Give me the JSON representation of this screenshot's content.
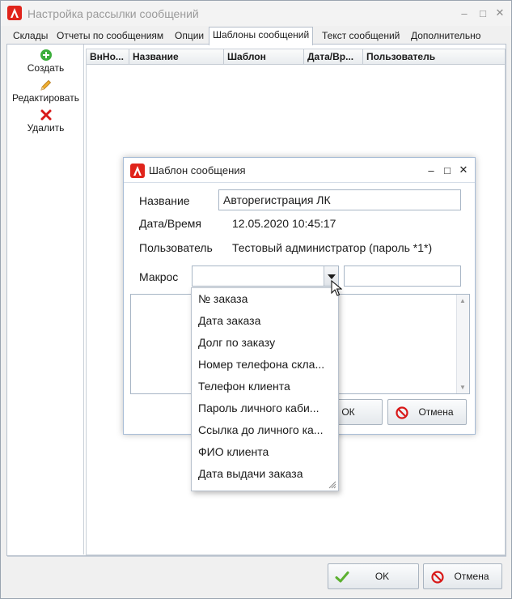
{
  "window": {
    "title": "Настройка рассылки сообщений",
    "minimize": "‒",
    "maximize": "□",
    "close": "✕"
  },
  "tabs": [
    {
      "label": "Склады"
    },
    {
      "label": "Отчеты по сообщениям"
    },
    {
      "label": "Опции"
    },
    {
      "label": "Шаблоны сообщений",
      "active": true
    },
    {
      "label": "Текст сообщений"
    },
    {
      "label": "Дополнительно"
    }
  ],
  "toolbar": {
    "create": "Создать",
    "edit": "Редактировать",
    "delete": "Удалить"
  },
  "grid": {
    "columns": [
      "ВнНо...",
      "Название",
      "Шаблон",
      "Дата/Вр...",
      "Пользователь"
    ]
  },
  "footer": {
    "ok": "OK",
    "cancel": "Отмена"
  },
  "dialog": {
    "title": "Шаблон сообщения",
    "name_label": "Название",
    "name_value": "Авторегистрация ЛК",
    "datetime_label": "Дата/Время",
    "datetime_value": "12.05.2020 10:45:17",
    "user_label": "Пользователь",
    "user_value": "Тестовый администратор (пароль *1*)",
    "macro_label": "Макрос",
    "macro_value": "",
    "macro_extra": "",
    "ok": "ОК",
    "cancel": "Отмена",
    "minimize": "‒",
    "maximize": "□",
    "close": "✕"
  },
  "dropdown": {
    "options": [
      "№ заказа",
      "Дата заказа",
      "Долг по заказу",
      "Номер телефона скла...",
      "Телефон клиента",
      "Пароль личного каби...",
      "Ссылка до личного ка...",
      "ФИО клиента",
      "Дата выдачи заказа"
    ]
  },
  "colors": {
    "logo_red": "#e0241b",
    "create_green": "#3cae3c",
    "delete_red": "#d81818",
    "ok_check": "#5bb030",
    "cancel_icon": "#d81818"
  }
}
